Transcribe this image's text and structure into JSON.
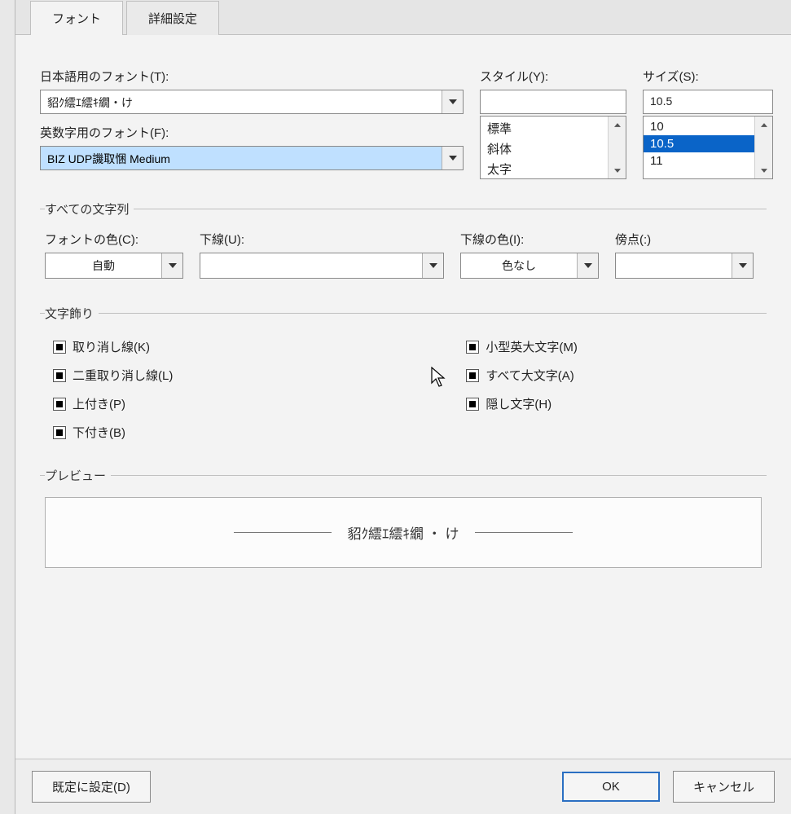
{
  "tabs": {
    "font": "フォント",
    "advanced": "詳細設定"
  },
  "labels": {
    "jp_font": "日本語用のフォント(T):",
    "latin_font": "英数字用のフォント(F):",
    "style": "スタイル(Y):",
    "size": "サイズ(S):",
    "all_text": "すべての文字列",
    "font_color": "フォントの色(C):",
    "underline": "下線(U):",
    "underline_color": "下線の色(I):",
    "emphasis": "傍点(:)",
    "effects": "文字飾り",
    "preview": "プレビュー"
  },
  "values": {
    "jp_font": "貂ｸ繧ｴ繧ｷ繝・け",
    "latin_font": "BIZ UDP譏取悃 Medium",
    "style": "",
    "size": "10.5",
    "font_color": "自動",
    "underline": "",
    "underline_color": "色なし",
    "emphasis": "",
    "preview_text": "貂ｸ繧ｴ繧ｷ繝 ・ け"
  },
  "style_options": [
    "標準",
    "斜体",
    "太字"
  ],
  "size_options": [
    "10",
    "10.5",
    "11"
  ],
  "size_selected_index": 1,
  "effects_left": [
    {
      "label": "取り消し線(K)"
    },
    {
      "label": "二重取り消し線(L)"
    },
    {
      "label": "上付き(P)"
    },
    {
      "label": "下付き(B)"
    }
  ],
  "effects_right": [
    {
      "label": "小型英大文字(M)"
    },
    {
      "label": "すべて大文字(A)"
    },
    {
      "label": "隠し文字(H)"
    }
  ],
  "buttons": {
    "set_default": "既定に設定(D)",
    "ok": "OK",
    "cancel": "キャンセル"
  }
}
